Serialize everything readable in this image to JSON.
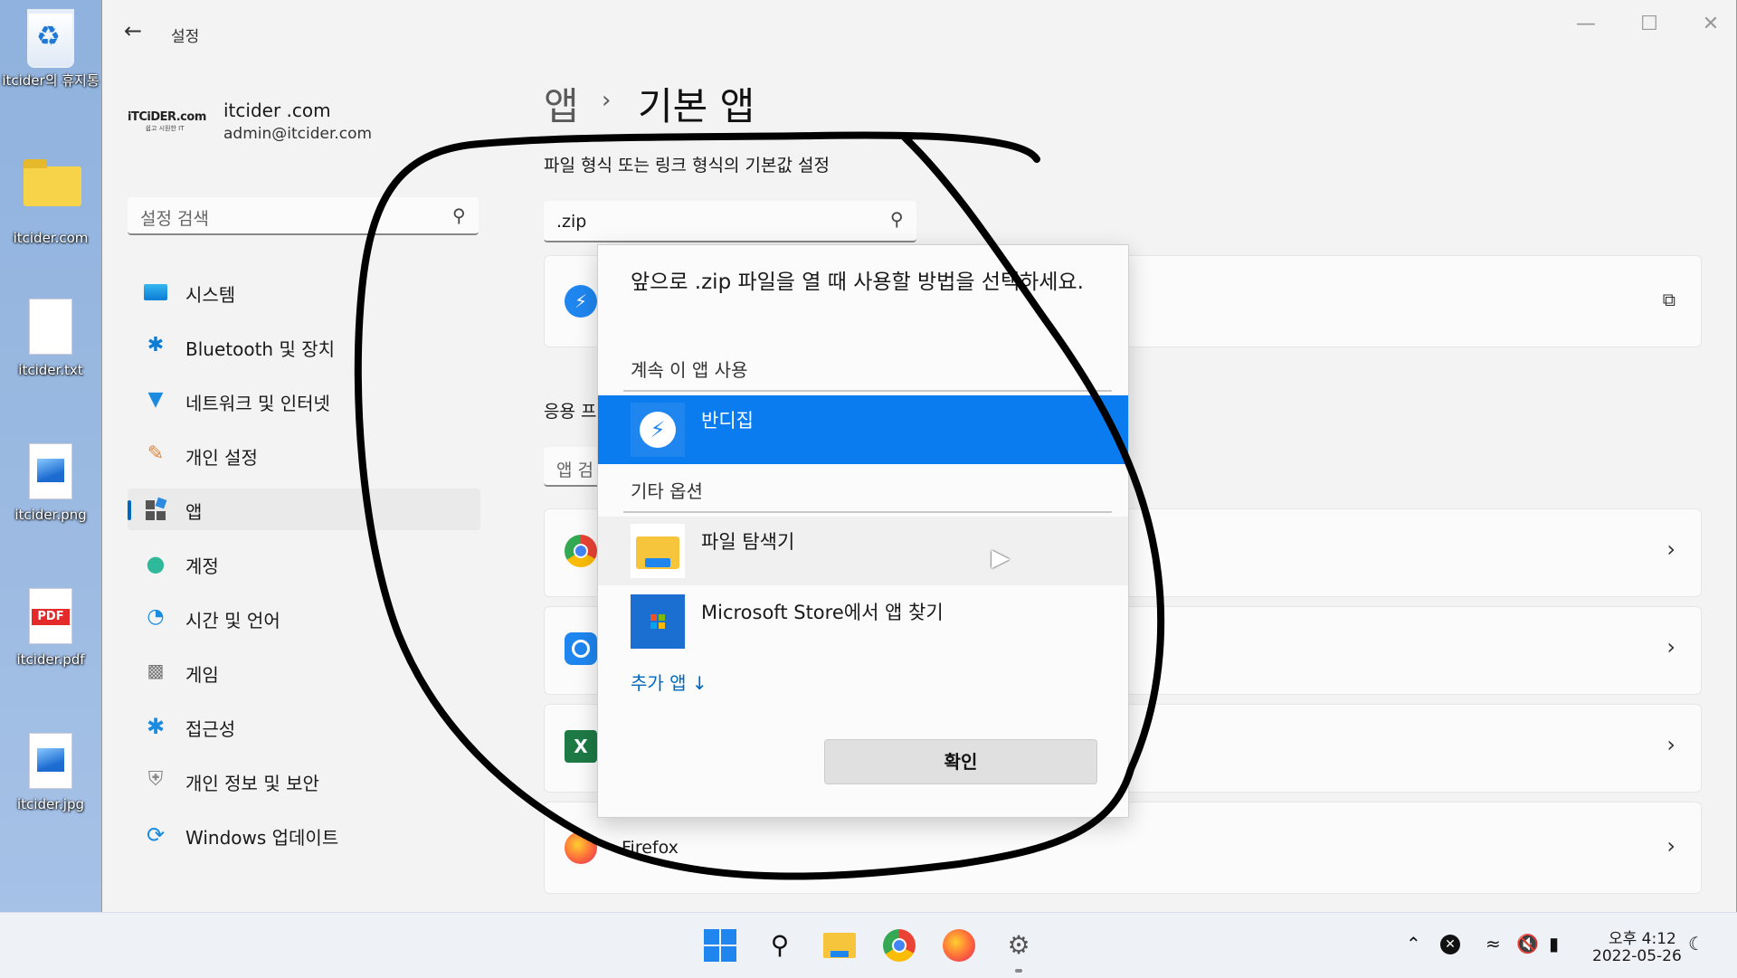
{
  "desktop": {
    "icons": [
      {
        "label": "itcider의 휴지통",
        "icon": "recycle-bin-icon"
      },
      {
        "label": "itcider.com",
        "icon": "folder-icon"
      },
      {
        "label": "itcider.txt",
        "icon": "text-file-icon"
      },
      {
        "label": "itcider.png",
        "icon": "image-file-icon"
      },
      {
        "label": "itcider.pdf",
        "icon": "pdf-file-icon"
      },
      {
        "label": "itcider.jpg",
        "icon": "image-file-icon"
      }
    ]
  },
  "window": {
    "title": "설정",
    "controls": {
      "minimize": "—",
      "maximize": "☐",
      "close": "✕"
    }
  },
  "account": {
    "logo_text": "iTCiDER.com",
    "logo_sub": "쉽고 시원한 IT",
    "name": "itcider .com",
    "email": "admin@itcider.com"
  },
  "sidebar": {
    "search_placeholder": "설정 검색",
    "items": [
      {
        "label": "시스템",
        "icon": "system-icon"
      },
      {
        "label": "Bluetooth 및 장치",
        "icon": "bluetooth-icon"
      },
      {
        "label": "네트워크 및 인터넷",
        "icon": "wifi-icon"
      },
      {
        "label": "개인 설정",
        "icon": "brush-icon"
      },
      {
        "label": "앱",
        "icon": "apps-icon",
        "active": true
      },
      {
        "label": "계정",
        "icon": "account-icon"
      },
      {
        "label": "시간 및 언어",
        "icon": "time-language-icon"
      },
      {
        "label": "게임",
        "icon": "gamepad-icon"
      },
      {
        "label": "접근성",
        "icon": "accessibility-icon"
      },
      {
        "label": "개인 정보 및 보안",
        "icon": "shield-icon"
      },
      {
        "label": "Windows 업데이트",
        "icon": "update-icon"
      }
    ]
  },
  "main": {
    "breadcrumb_parent": "앱",
    "breadcrumb_sep": "›",
    "breadcrumb_current": "기본 앱",
    "subtitle": "파일 형식 또는 링크 형식의 기본값 설정",
    "search_value": ".zip",
    "apps_section_label": "응용 프",
    "apps_search_placeholder": "앱 검",
    "firefox_label": "Firefox"
  },
  "dialog": {
    "prompt": "앞으로 .zip 파일을 열 때 사용할 방법을 선택하세요.",
    "keep_using_header": "계속 이 앱 사용",
    "selected_app": "반디집",
    "other_options_header": "기타 옵션",
    "options": [
      {
        "label": "파일 탐색기",
        "icon": "file-explorer-icon"
      },
      {
        "label": "Microsoft Store에서 앱 찾기",
        "icon": "microsoft-store-icon"
      }
    ],
    "more_apps": "추가 앱 ↓",
    "ok_label": "확인"
  },
  "taskbar": {
    "apps": [
      "windows-start-icon",
      "search-icon",
      "file-explorer-icon",
      "chrome-icon",
      "firefox-icon",
      "settings-icon"
    ],
    "time": "오후 4:12",
    "date": "2022-05-26"
  },
  "colors": {
    "accent": "#0a7cf0",
    "annotation": "#000000",
    "desktop_bg": "#9ab9e1"
  }
}
